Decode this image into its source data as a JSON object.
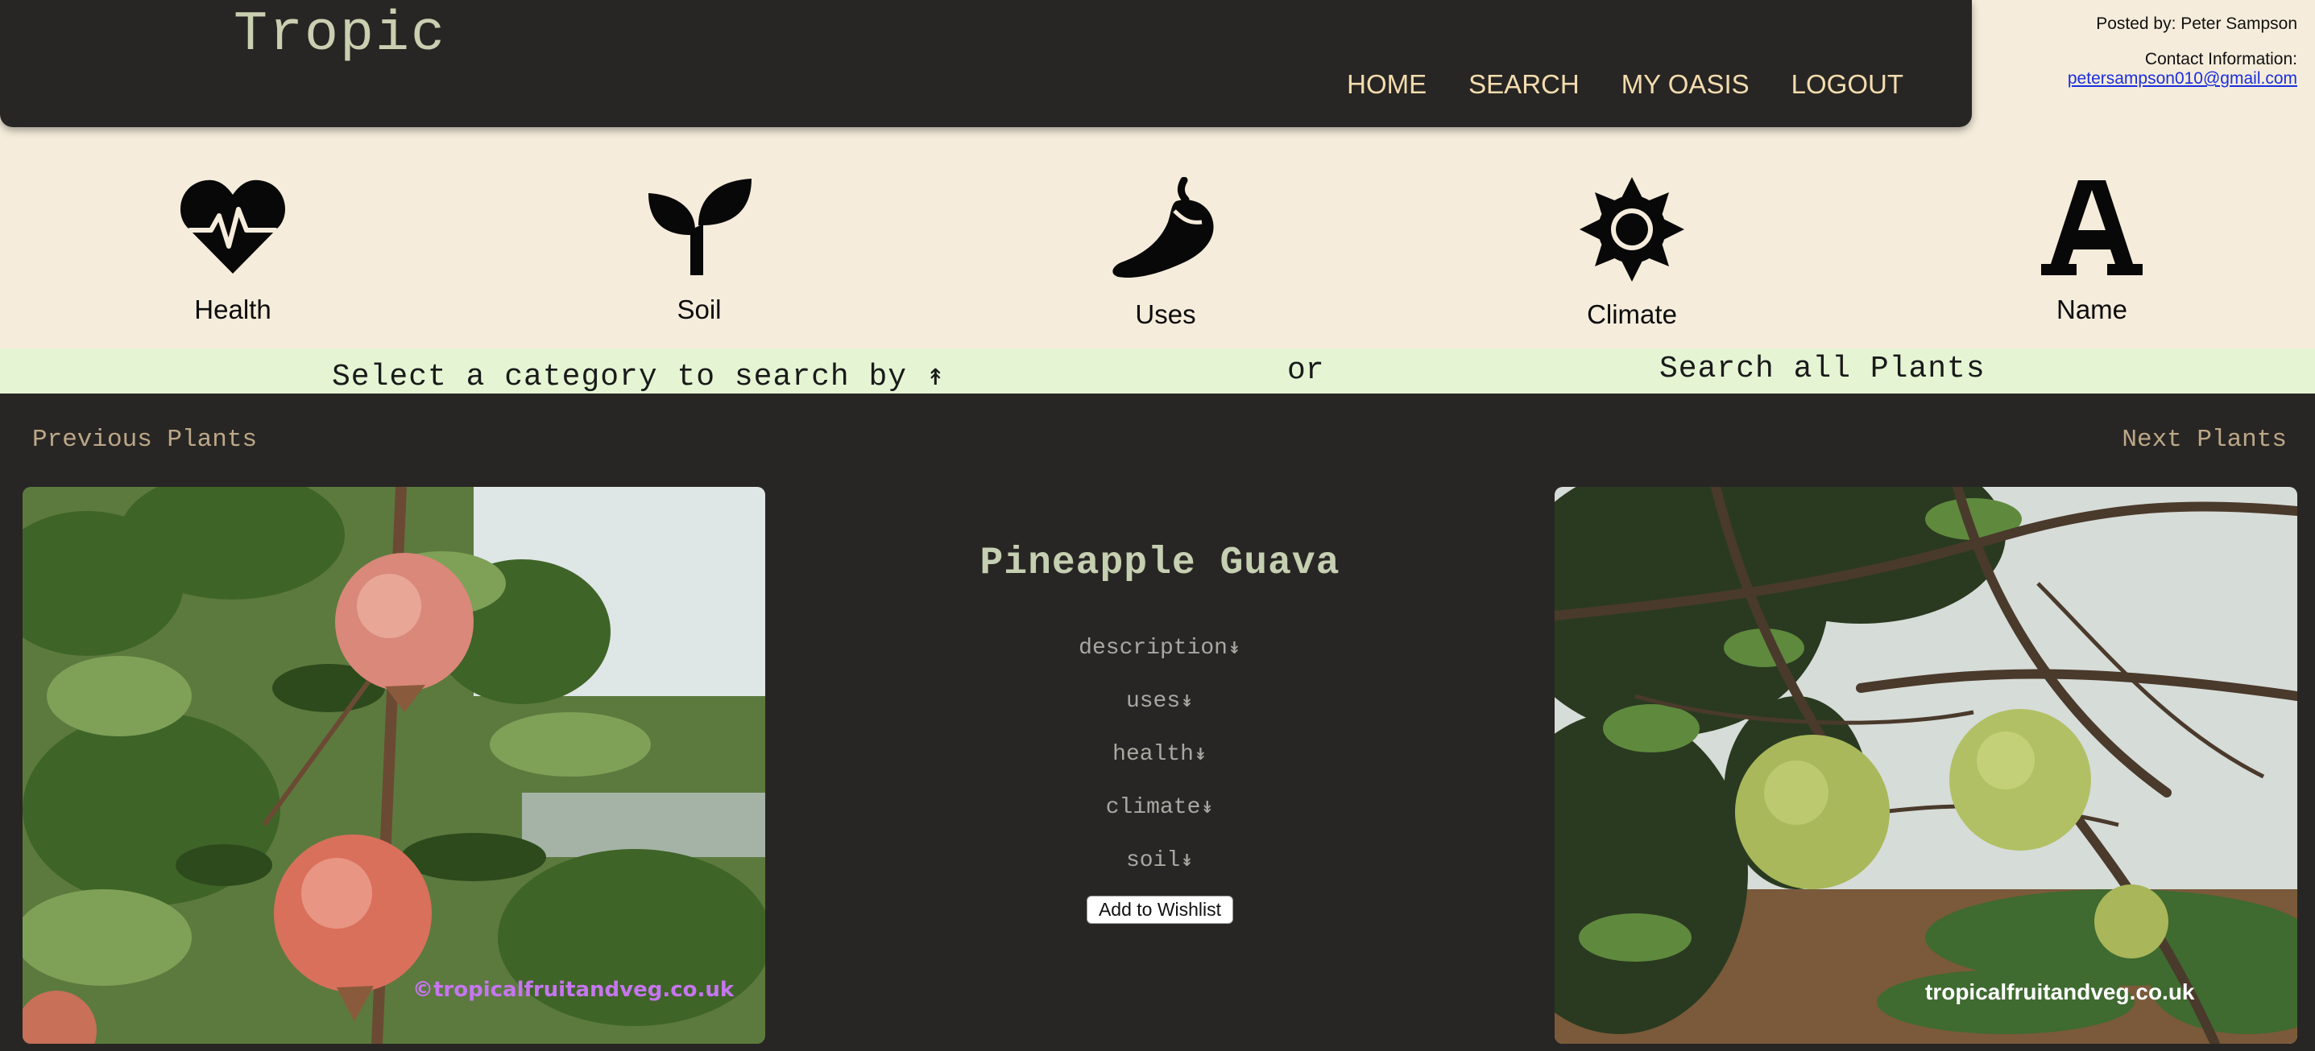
{
  "header": {
    "logo": "Tropic",
    "nav": [
      "HOME",
      "SEARCH",
      "MY OASIS",
      "LOGOUT"
    ]
  },
  "contact": {
    "posted_by": "Posted by: Peter Sampson",
    "contact_label": "Contact Information:",
    "email": "petersampson010@gmail.com"
  },
  "categories": [
    {
      "label": "Health",
      "icon": "heartbeat-icon"
    },
    {
      "label": "Soil",
      "icon": "seedling-icon"
    },
    {
      "label": "Uses",
      "icon": "pepper-icon"
    },
    {
      "label": "Climate",
      "icon": "sun-icon"
    },
    {
      "label": "Name",
      "icon": "letter-a-icon"
    }
  ],
  "search_strip": {
    "select_text": "Select a category to search by ↟",
    "or_text": "or",
    "search_all": "Search all Plants"
  },
  "pager": {
    "previous": "Previous Plants",
    "next": "Next Plants"
  },
  "plant": {
    "name": "Pineapple Guava",
    "details": [
      "description↡",
      "uses↡",
      "health↡",
      "climate↡",
      "soil↡"
    ],
    "wishlist_button": "Add to Wishlist"
  },
  "photos": {
    "left_watermark": "©tropicalfruitandveg.co.uk",
    "right_watermark": "tropicalfruitandveg.co.uk"
  },
  "colors": {
    "background": "#f5ecdb",
    "dark": "#282624",
    "nav_text": "#f3dcae",
    "strip": "#e5f5d4",
    "title": "#c5cfb1",
    "pager": "#bca888"
  }
}
